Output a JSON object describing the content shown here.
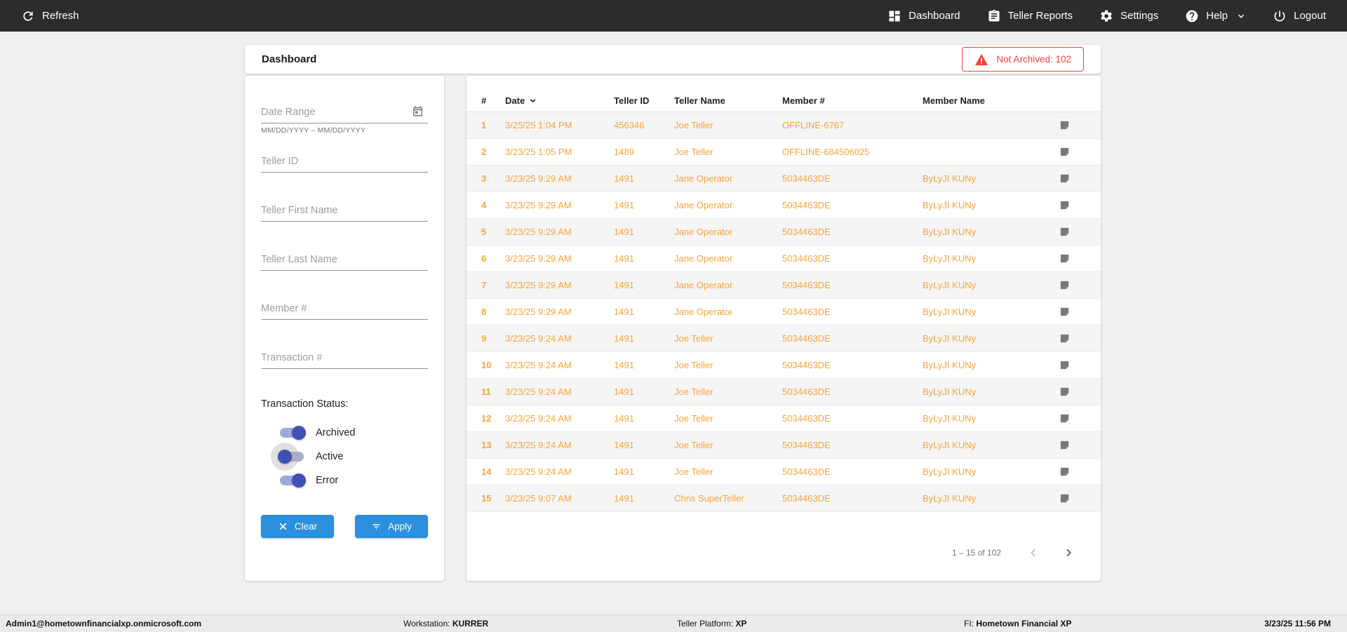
{
  "topnav": {
    "refresh_label": "Refresh",
    "items": [
      {
        "label": "Dashboard",
        "icon": "dashboard-icon"
      },
      {
        "label": "Teller Reports",
        "icon": "clipboard-icon"
      },
      {
        "label": "Settings",
        "icon": "gear-icon"
      },
      {
        "label": "Help",
        "icon": "help-icon",
        "has_chevron": true
      },
      {
        "label": "Logout",
        "icon": "power-icon"
      }
    ]
  },
  "header": {
    "title": "Dashboard",
    "not_archived_label": "Not Archived: 102",
    "not_archived_count": 102
  },
  "filters": {
    "date_range": {
      "placeholder": "Date Range",
      "hint": "MM/DD/YYYY – MM/DD/YYYY",
      "icon": "calendar-icon"
    },
    "teller_id_placeholder": "Teller ID",
    "teller_first_name_placeholder": "Teller First Name",
    "teller_last_name_placeholder": "Teller Last Name",
    "member_num_placeholder": "Member #",
    "transaction_num_placeholder": "Transaction #",
    "status_label": "Transaction Status:",
    "toggles": [
      {
        "label": "Archived",
        "on": true,
        "ripple": false
      },
      {
        "label": "Active",
        "on": false,
        "ripple": true
      },
      {
        "label": "Error",
        "on": true,
        "ripple": false
      }
    ],
    "clear_label": "Clear",
    "apply_label": "Apply"
  },
  "table": {
    "columns": [
      "#",
      "Date",
      "Teller ID",
      "Teller Name",
      "Member #",
      "Member Name"
    ],
    "sorted_by": "Date",
    "sort_direction": "desc",
    "rows": [
      {
        "num": "1",
        "date": "3/25/25 1:04 PM",
        "teller_id": "456346",
        "teller_name": "Joe Teller",
        "member": "OFFLINE-6767",
        "member_name": ""
      },
      {
        "num": "2",
        "date": "3/23/25 1:05 PM",
        "teller_id": "1489",
        "teller_name": "Joe Teller",
        "member": "OFFLINE-684506025",
        "member_name": ""
      },
      {
        "num": "3",
        "date": "3/23/25 9:29 AM",
        "teller_id": "1491",
        "teller_name": "Jane Operator",
        "member": "5034463DE",
        "member_name": "ByLyJI KUNy"
      },
      {
        "num": "4",
        "date": "3/23/25 9:29 AM",
        "teller_id": "1491",
        "teller_name": "Jane Operator",
        "member": "5034463DE",
        "member_name": "ByLyJI KUNy"
      },
      {
        "num": "5",
        "date": "3/23/25 9:29 AM",
        "teller_id": "1491",
        "teller_name": "Jane Operator",
        "member": "5034463DE",
        "member_name": "ByLyJI KUNy"
      },
      {
        "num": "6",
        "date": "3/23/25 9:29 AM",
        "teller_id": "1491",
        "teller_name": "Jane Operator",
        "member": "5034463DE",
        "member_name": "ByLyJI KUNy"
      },
      {
        "num": "7",
        "date": "3/23/25 9:29 AM",
        "teller_id": "1491",
        "teller_name": "Jane Operator",
        "member": "5034463DE",
        "member_name": "ByLyJI KUNy"
      },
      {
        "num": "8",
        "date": "3/23/25 9:29 AM",
        "teller_id": "1491",
        "teller_name": "Jane Operator",
        "member": "5034463DE",
        "member_name": "ByLyJI KUNy"
      },
      {
        "num": "9",
        "date": "3/23/25 9:24 AM",
        "teller_id": "1491",
        "teller_name": "Joe Teller",
        "member": "5034463DE",
        "member_name": "ByLyJI KUNy"
      },
      {
        "num": "10",
        "date": "3/23/25 9:24 AM",
        "teller_id": "1491",
        "teller_name": "Joe Teller",
        "member": "5034463DE",
        "member_name": "ByLyJI KUNy"
      },
      {
        "num": "11",
        "date": "3/23/25 9:24 AM",
        "teller_id": "1491",
        "teller_name": "Joe Teller",
        "member": "5034463DE",
        "member_name": "ByLyJI KUNy"
      },
      {
        "num": "12",
        "date": "3/23/25 9:24 AM",
        "teller_id": "1491",
        "teller_name": "Joe Teller",
        "member": "5034463DE",
        "member_name": "ByLyJI KUNy"
      },
      {
        "num": "13",
        "date": "3/23/25 9:24 AM",
        "teller_id": "1491",
        "teller_name": "Joe Teller",
        "member": "5034463DE",
        "member_name": "ByLyJI KUNy"
      },
      {
        "num": "14",
        "date": "3/23/25 9:24 AM",
        "teller_id": "1491",
        "teller_name": "Joe Teller",
        "member": "5034463DE",
        "member_name": "ByLyJI KUNy"
      },
      {
        "num": "15",
        "date": "3/23/25 9:07 AM",
        "teller_id": "1491",
        "teller_name": "Chris SuperTeller",
        "member": "5034463DE",
        "member_name": "ByLyJI KUNy"
      }
    ],
    "pagination": {
      "range_label": "1 – 15 of 102",
      "prev_enabled": false,
      "next_enabled": true
    }
  },
  "footer": {
    "user": "Admin1@hometownfinancialxp.onmicrosoft.com",
    "workstation_label": "Workstation:",
    "workstation_value": "KURRER",
    "platform_label": "Teller Platform:",
    "platform_value": "XP",
    "fi_label": "FI:",
    "fi_value": "Hometown Financial XP",
    "datetime": "3/23/25 11:56 PM"
  },
  "colors": {
    "accent_orange": "#F9A43B",
    "button_blue": "#2B90DD",
    "toggle_indigo": "#3F51B5",
    "alert_red": "#F44336",
    "topnav_bg": "#2C2C2C"
  }
}
